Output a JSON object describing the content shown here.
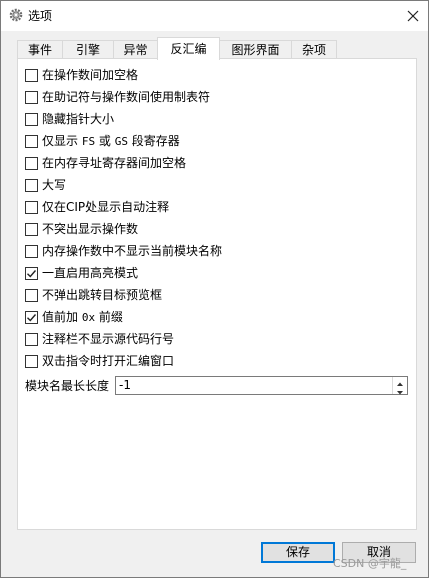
{
  "window": {
    "title": "选项",
    "app_icon": "gear-icon",
    "close_icon": "close-icon"
  },
  "tabs": [
    {
      "label": "事件",
      "active": false
    },
    {
      "label": "引擎",
      "active": false
    },
    {
      "label": "异常",
      "active": false
    },
    {
      "label": "反汇编",
      "active": true
    },
    {
      "label": "图形界面",
      "active": false
    },
    {
      "label": "杂项",
      "active": false
    }
  ],
  "options": [
    {
      "label": "在操作数间加空格",
      "checked": false
    },
    {
      "label": "在助记符与操作数间使用制表符",
      "checked": false
    },
    {
      "label": "隐藏指针大小",
      "checked": false
    },
    {
      "label_parts": [
        "仅显示 ",
        "FS",
        " 或 ",
        "GS",
        " 段寄存器"
      ],
      "checked": false
    },
    {
      "label": "在内存寻址寄存器间加空格",
      "checked": false
    },
    {
      "label": "大写",
      "checked": false
    },
    {
      "label": "仅在CIP处显示自动注释",
      "checked": false
    },
    {
      "label": "不突出显示操作数",
      "checked": false
    },
    {
      "label": "内存操作数中不显示当前模块名称",
      "checked": false
    },
    {
      "label": "一直启用高亮模式",
      "checked": true
    },
    {
      "label": "不弹出跳转目标预览框",
      "checked": false
    },
    {
      "label_parts": [
        "值前加 ",
        "0x",
        " 前缀"
      ],
      "checked": true
    },
    {
      "label": "注释栏不显示源代码行号",
      "checked": false
    },
    {
      "label": "双击指令时打开汇编窗口",
      "checked": false
    }
  ],
  "module_name_max_length": {
    "label": "模块名最长长度",
    "value": "-1"
  },
  "buttons": {
    "save": "保存",
    "cancel": "取消"
  },
  "watermark": "CSDN @宇龍_"
}
